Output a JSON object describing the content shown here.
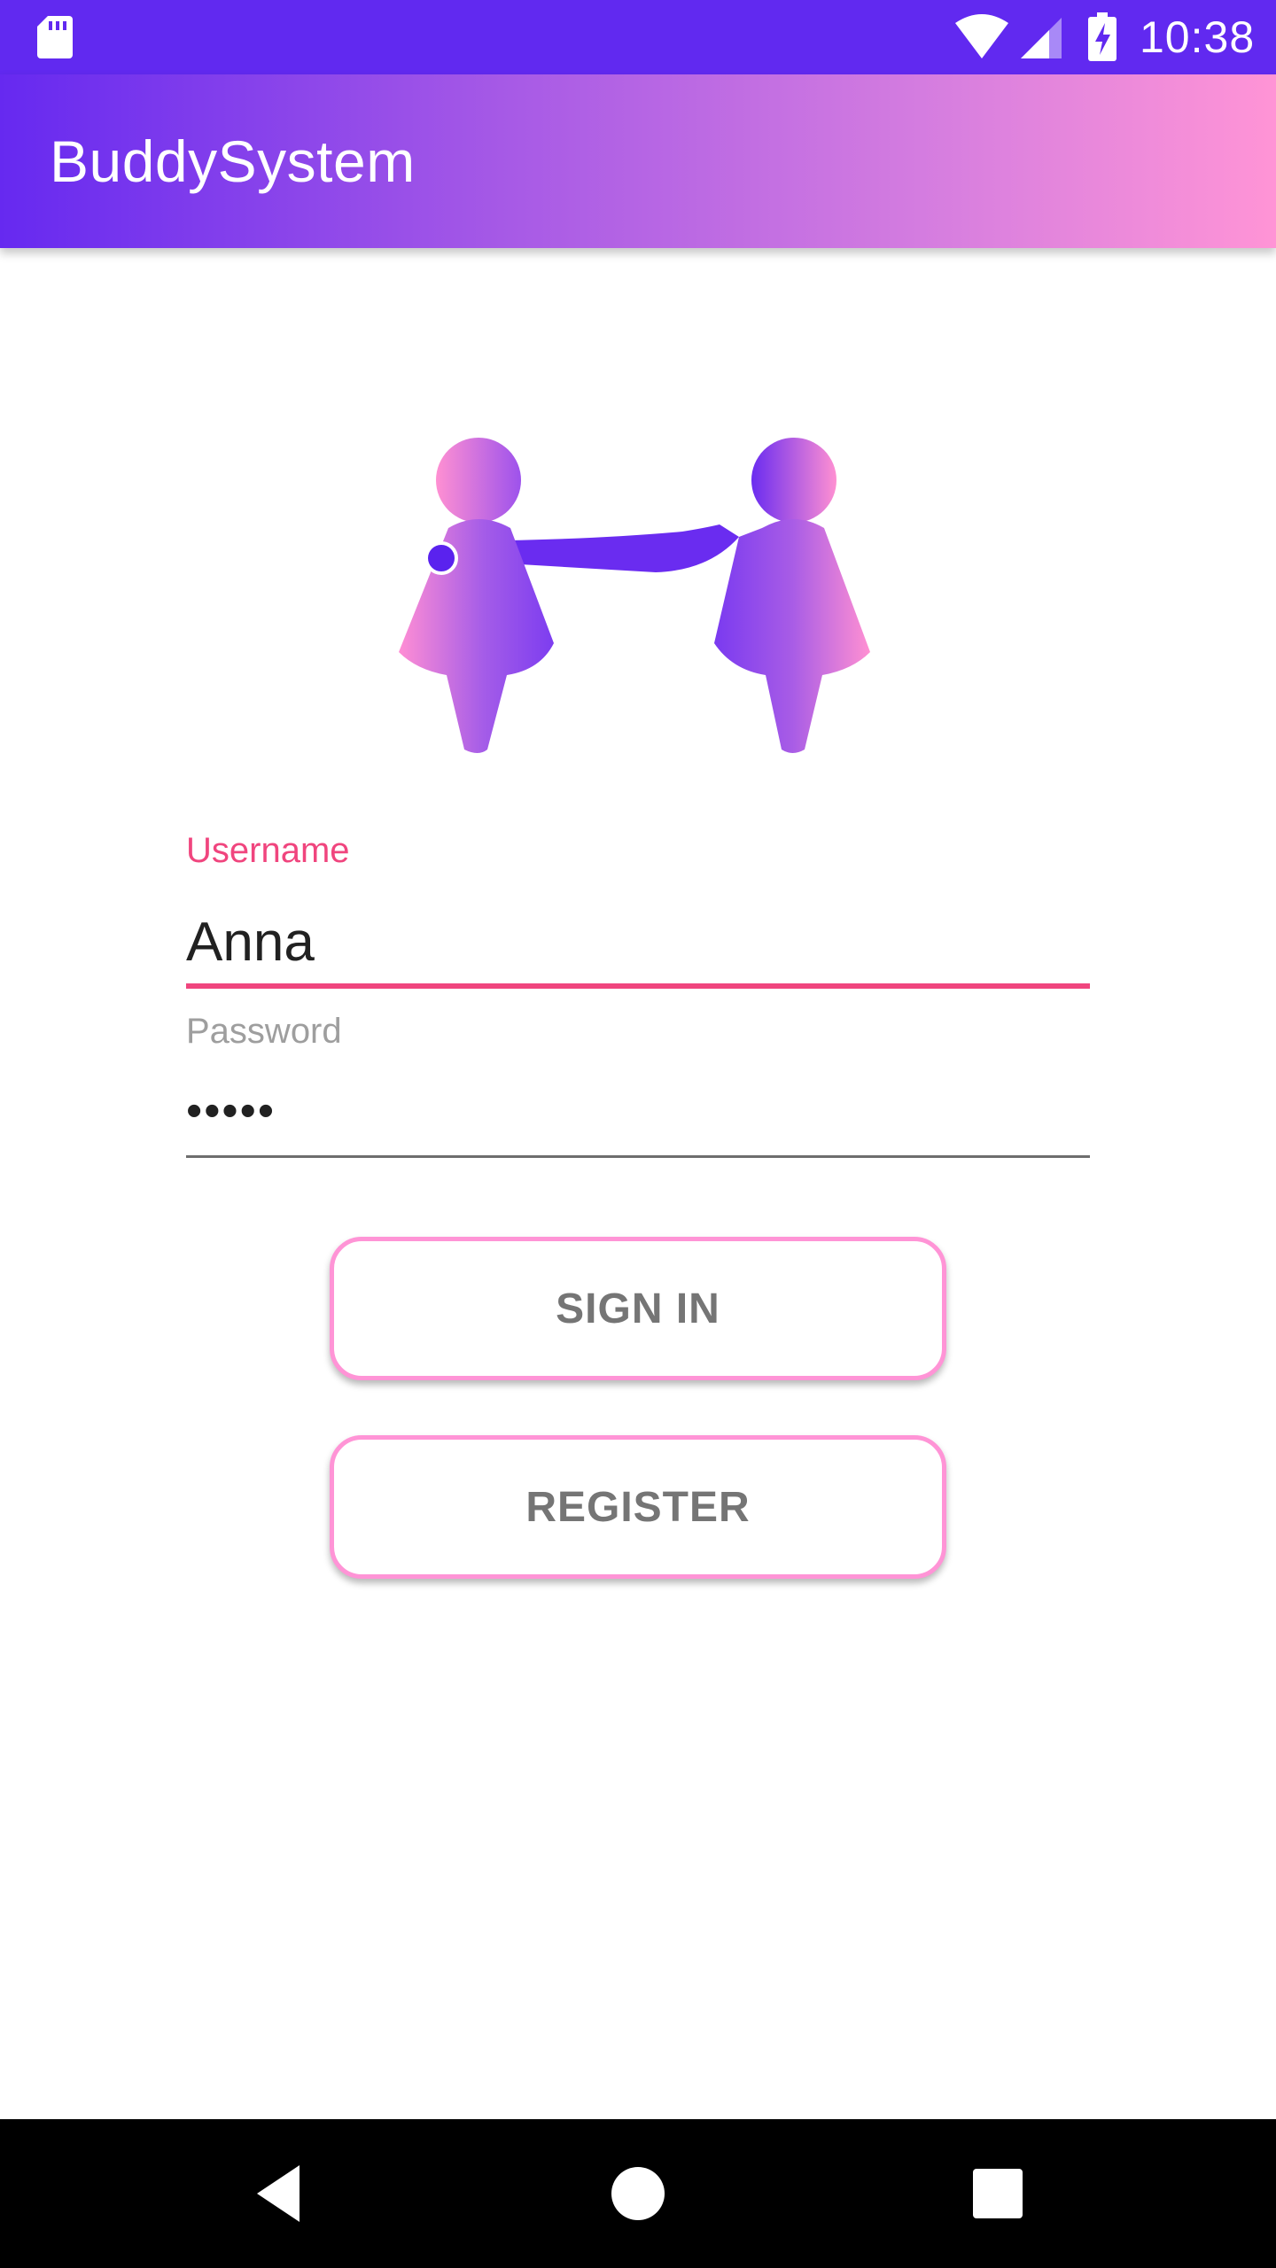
{
  "status_bar": {
    "time": "10:38",
    "icons": [
      "sd-card-icon",
      "wifi-icon",
      "cell-signal-icon",
      "battery-charging-icon"
    ]
  },
  "app_bar": {
    "title": "BuddySystem",
    "gradient": [
      "#6629f0",
      "#ff94d6"
    ]
  },
  "logo": {
    "icon": "two-buddies-holding-hands-icon"
  },
  "form": {
    "username": {
      "label": "Username",
      "value": "Anna"
    },
    "password": {
      "label": "Password",
      "value": "•••••"
    }
  },
  "buttons": {
    "sign_in": "SIGN IN",
    "register": "REGISTER"
  },
  "nav_bar": {
    "icons": [
      "back-icon",
      "home-icon",
      "recents-icon"
    ]
  },
  "colors": {
    "primary": "#6129f0",
    "accent": "#f0457e",
    "button_border": "#ff94d6"
  }
}
